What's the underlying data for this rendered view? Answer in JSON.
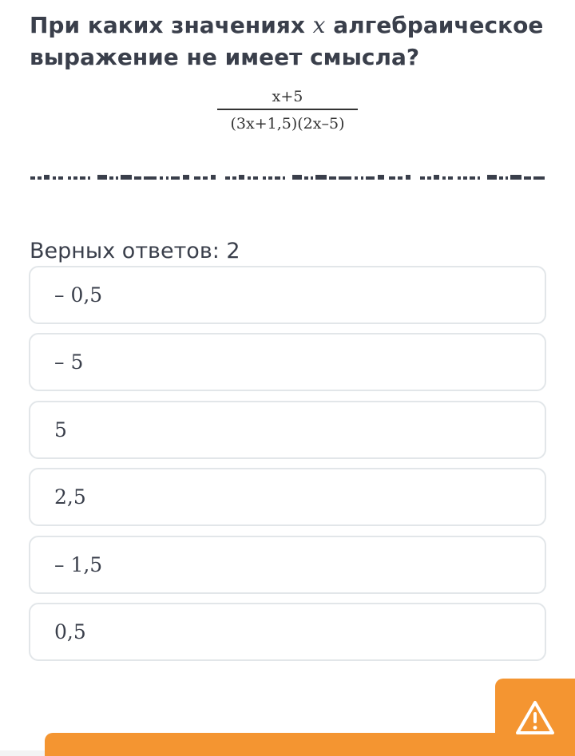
{
  "question": {
    "text_before": "При каких значениях ",
    "variable": "x",
    "text_after": " алгебраическое выражение не имеет смысла?"
  },
  "expression": {
    "numerator": "x+5",
    "denominator": "(3x+1,5)(2x–5)"
  },
  "answers_count_label": "Верных ответов: 2",
  "options": [
    {
      "label": "– 0,5"
    },
    {
      "label": "– 5"
    },
    {
      "label": "5"
    },
    {
      "label": "2,5"
    },
    {
      "label": "– 1,5"
    },
    {
      "label": "0,5"
    }
  ],
  "colors": {
    "accent": "#f49531",
    "text": "#3a3f4b",
    "option_border": "#e2e6e9"
  },
  "icons": {
    "warning": "warning-triangle-icon"
  }
}
